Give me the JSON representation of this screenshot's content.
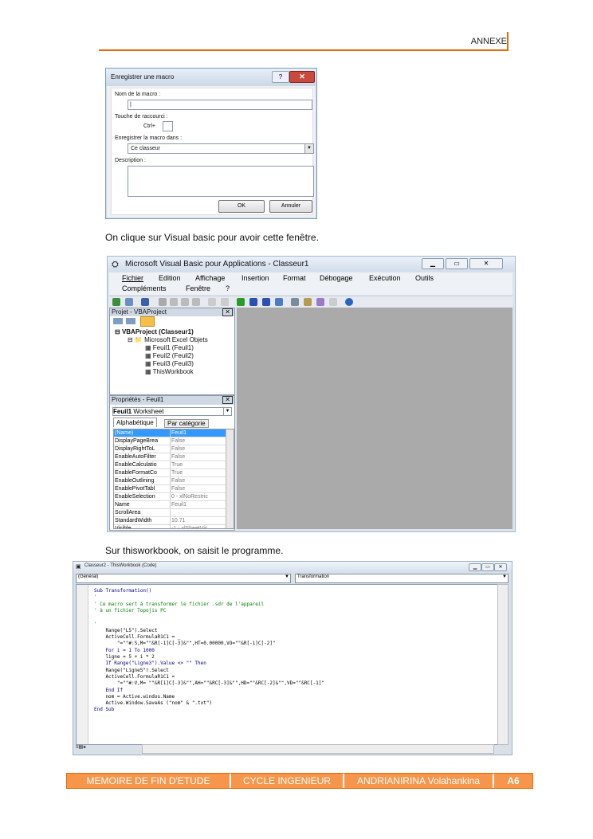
{
  "header": {
    "text": "ANNEXE"
  },
  "dialog": {
    "title": "Enregistrer une macro",
    "help_label": "?",
    "close_label": "✕",
    "name_label": "Nom de la macro :",
    "name_value": "|",
    "shortcut_label": "Touche de raccourci :",
    "ctrl_label": "Ctrl+",
    "store_label": "Enregistrer la macro dans :",
    "store_value": "Ce classeur",
    "description_label": "Description :",
    "ok_label": "OK",
    "cancel_label": "Annuler"
  },
  "paragraph1": "On clique sur Visual basic pour avoir cette fenêtre.",
  "vba": {
    "title": "Microsoft Visual Basic pour Applications - Classeur1",
    "menu_row1": [
      "Fichier",
      "Edition",
      "Affichage",
      "Insertion",
      "Format",
      "Débogage",
      "Exécution",
      "Outils"
    ],
    "menu_row2": [
      "Compléments",
      "Fenêtre",
      "?"
    ],
    "project_title": "Projet - VBAProject",
    "tree": [
      "VBAProject (Classeur1)",
      "Microsoft Excel Objets",
      "Feuil1 (Feuil1)",
      "Feuil2 (Feuil2)",
      "Feuil3 (Feuil3)",
      "ThisWorkbook"
    ],
    "props_title": "Propriétés - Feuil1",
    "props_object_bold": "Feuil1",
    "props_object_type": "Worksheet",
    "tab_alpha": "Alphabétique",
    "tab_cat": "Par catégorie",
    "properties": [
      [
        "(Name)",
        "Feuil1"
      ],
      [
        "DisplayPageBrea",
        "False"
      ],
      [
        "DisplayRightToL",
        "False"
      ],
      [
        "EnableAutoFilter",
        "False"
      ],
      [
        "EnableCalculatio",
        "True"
      ],
      [
        "EnableFormatCo",
        "True"
      ],
      [
        "EnableOutlining",
        "False"
      ],
      [
        "EnablePivotTabl",
        "False"
      ],
      [
        "EnableSelection",
        "0 - xlNoRestric"
      ],
      [
        "Name",
        "Feuil1"
      ],
      [
        "ScrollArea",
        ""
      ],
      [
        "StandardWidth",
        "10.71"
      ],
      [
        "Visible",
        "-1 - xlSheetVis"
      ]
    ]
  },
  "paragraph2": "Sur thisworkbook, on saisit le programme.",
  "code": {
    "title": "Classeur2 - ThisWorkbook (Code)",
    "combo_left": "(Général)",
    "combo_right": "Transformation",
    "lines": [
      {
        "t": "Sub Transformation()",
        "c": "#000080"
      },
      {
        "t": "'",
        "c": "#008000"
      },
      {
        "t": "' Ce macro sert à transformer le fichier .sdr de l'appareil",
        "c": "#008000"
      },
      {
        "t": "' à un fichier Topojis PC",
        "c": "#008000"
      },
      {
        "t": "",
        "c": "#000"
      },
      {
        "t": "'",
        "c": "#008000"
      },
      {
        "t": "    Range(\"L5\").Select",
        "c": "#000"
      },
      {
        "t": "    ActiveCell.FormulaR1C1 = _",
        "c": "#000"
      },
      {
        "t": "        \"=\"\"#:S,M=\"\"&R[-1]C[-3]&\"\",HT=0.00000,VO=\"\"&R[-1]C[-2]\"",
        "c": "#000"
      },
      {
        "t": "    For i = 1 To 1000",
        "c": "#000080"
      },
      {
        "t": "    ligne = 5 + i * 2",
        "c": "#000"
      },
      {
        "t": "    If Range(\"Ligne3\").Value <> \"\" Then",
        "c": "#000080"
      },
      {
        "t": "    Range(\"Ligne5\").Select",
        "c": "#000"
      },
      {
        "t": "    ActiveCell.FormulaR1C1 =",
        "c": "#000"
      },
      {
        "t": "        \"=\"\"#:V,M= \"\"&R[1]C[-3]&\"\",AH=\"\"&RC[-3]&\"\",HD=\"\"&RC[-2]&\"\",VD=\"\"&RC[-1]\"",
        "c": "#000"
      },
      {
        "t": "    End If",
        "c": "#000080"
      },
      {
        "t": "    nom = Active.windos.Name",
        "c": "#000"
      },
      {
        "t": "    Active.Window.SaveAs (\"nom\" & \".txt\")",
        "c": "#000"
      },
      {
        "t": "End Sub",
        "c": "#000080"
      }
    ]
  },
  "footer": {
    "cell1": "MEMOIRE DE FIN D'ETUDE",
    "cell2": "CYCLE INGENIEUR",
    "cell3": "ANDRIANIRINA Volahankina",
    "cell4": "A6"
  },
  "colors": {
    "accent": "#e36c0a",
    "footer_fill": "#f7964a"
  }
}
